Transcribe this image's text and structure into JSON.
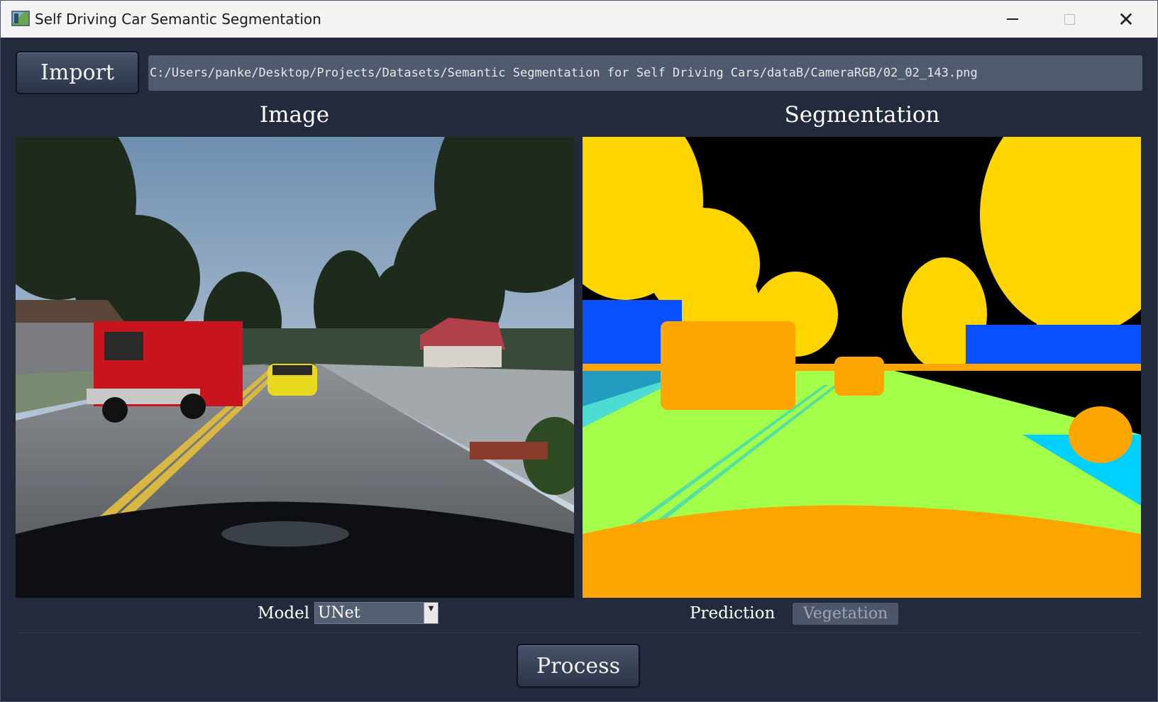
{
  "window": {
    "title": "Self Driving Car Semantic Segmentation"
  },
  "toolbar": {
    "import_label": "Import",
    "file_path": "C:/Users/panke/Desktop/Projects/Datasets/Semantic Segmentation for Self Driving Cars/dataB/CameraRGB/02_02_143.png"
  },
  "panels": {
    "image_title": "Image",
    "segmentation_title": "Segmentation"
  },
  "controls": {
    "model_label": "Model",
    "model_selected": "UNet",
    "prediction_label": "Prediction",
    "prediction_value": "Vegetation",
    "process_label": "Process"
  },
  "icons": {
    "app": "app-icon",
    "minimize": "minimize-icon",
    "maximize": "maximize-icon",
    "close": "close-icon",
    "dropdown": "chevron-down-icon"
  },
  "colors": {
    "window_bg": "#222a3c",
    "button_bg": "#3a4459",
    "field_bg": "#505a6d",
    "seg_vegetation": "#ffd500",
    "seg_road": "#a4ff4a",
    "seg_vehicle": "#ffa500",
    "seg_building": "#0a50ff",
    "seg_sky": "#000000"
  }
}
